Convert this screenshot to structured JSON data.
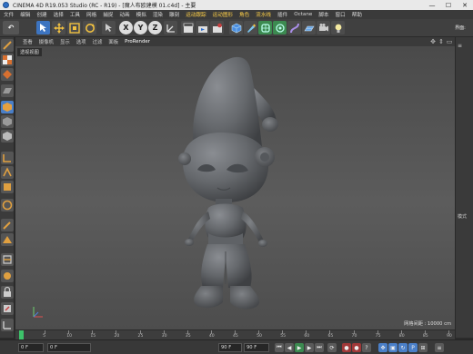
{
  "title": {
    "text": "CINEMA 4D R19.053 Studio (RC - R19) - [魔人布欧建模 01.c4d] - 主要",
    "minimize": "—",
    "maximize": "☐",
    "close": "✕"
  },
  "menu": [
    "文件",
    "编辑",
    "创建",
    "选择",
    "工具",
    "网格",
    "捕捉",
    "动画",
    "模拟",
    "渲染",
    "雕刻",
    "运动跟踪",
    "运动图形",
    "角色",
    "流水线",
    "插件",
    "Octane",
    "脚本",
    "窗口",
    "帮助"
  ],
  "menu_highlight": [
    "运动跟踪",
    "运动图形",
    "角色",
    "流水线"
  ],
  "toolbar": {
    "undo_label": "↶",
    "axis_x": "X",
    "axis_y": "Y",
    "axis_z": "Z",
    "layout_label": "界面:"
  },
  "viewport": {
    "menus": [
      "查看",
      "摄像机",
      "显示",
      "选项",
      "过滤",
      "面板",
      "ProRender"
    ],
    "label": "透视视图",
    "grid_info": "网格间距 : 10000 cm"
  },
  "timeline": {
    "ticks": [
      "0",
      "5",
      "10",
      "15",
      "20",
      "25",
      "30",
      "35",
      "40",
      "45",
      "50",
      "55",
      "60",
      "65",
      "70",
      "75",
      "80",
      "85",
      "90"
    ],
    "end_label": "0 F"
  },
  "transport": {
    "start_frame": "0 F",
    "current_frame": "0 F",
    "end_frame": "90 F",
    "end_frame_2": "90 F"
  },
  "right_panel": {
    "label": "模式"
  },
  "colors": {
    "accent_blue": "#2f6fc4",
    "tool_blue": "#3d74c0",
    "highlight_yellow": "#ffd048",
    "model_gray": "#6b6e72"
  }
}
